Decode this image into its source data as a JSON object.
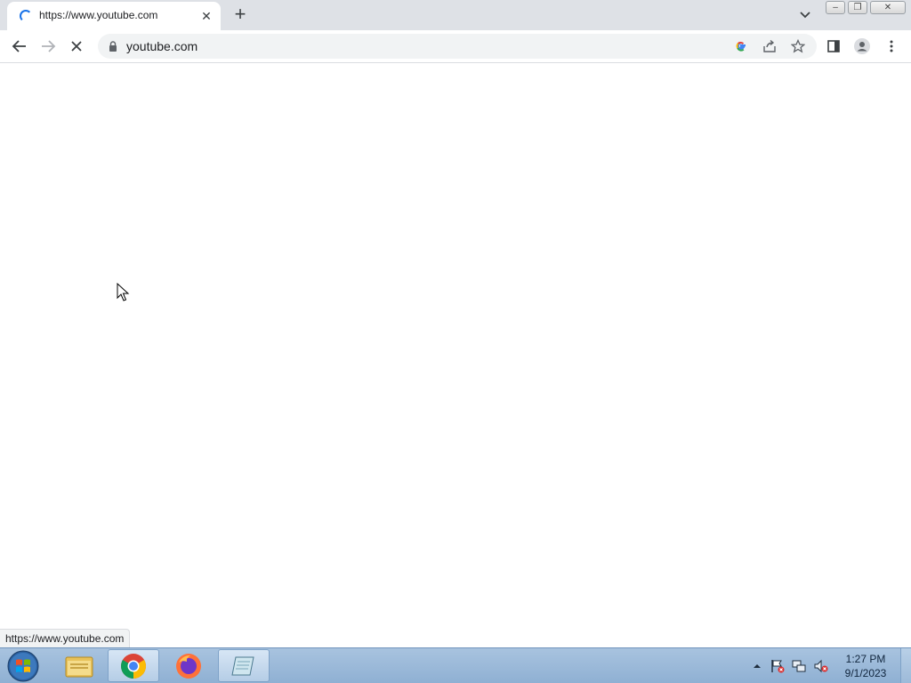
{
  "browser": {
    "tab": {
      "title": "https://www.youtube.com",
      "close_glyph": "✕",
      "loading": true
    },
    "new_tab_glyph": "+",
    "tab_search_icon": "chevron-down-icon",
    "window_controls": {
      "minimize": "–",
      "restore": "❐",
      "close": "✕"
    },
    "toolbar": {
      "back_icon": "arrow-left-icon",
      "forward_icon": "arrow-right-icon",
      "stop_icon": "close-icon",
      "url": "youtube.com",
      "omnibox_icons": [
        "google-icon",
        "share-icon",
        "star-icon"
      ],
      "side_panel_icon": "side-panel-icon",
      "profile_icon": "profile-icon",
      "menu_icon": "kebab-menu-icon"
    },
    "status_url": "https://www.youtube.com"
  },
  "taskbar": {
    "apps": [
      "file-explorer",
      "chrome",
      "firefox",
      "notepad"
    ],
    "active_app": "chrome",
    "clock": {
      "time": "1:27 PM",
      "date": "9/1/2023"
    }
  },
  "colors": {
    "tab_strip": "#dee1e6",
    "omnibox": "#f1f3f4",
    "accent": "#1a73e8",
    "taskbar": "#9bb8d9"
  }
}
